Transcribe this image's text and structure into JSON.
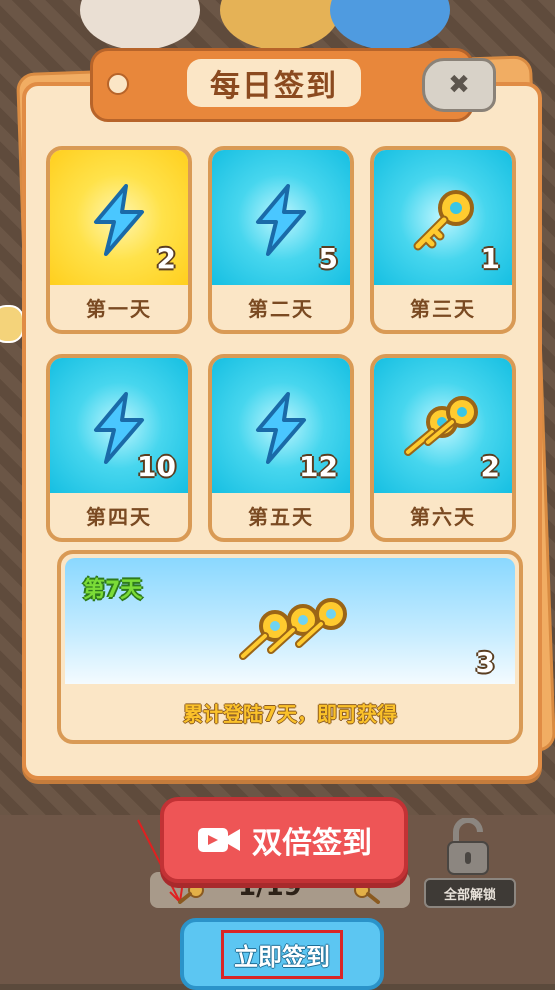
{
  "title": "每日签到",
  "close_icon": "close-x-icon",
  "days": [
    {
      "label": "第一天",
      "reward": "lightning-energy-icon",
      "count": "2",
      "highlight": true
    },
    {
      "label": "第二天",
      "reward": "lightning-energy-icon",
      "count": "5",
      "highlight": false
    },
    {
      "label": "第三天",
      "reward": "golden-key-icon",
      "count": "1",
      "highlight": false
    },
    {
      "label": "第四天",
      "reward": "lightning-energy-icon",
      "count": "10",
      "highlight": false
    },
    {
      "label": "第五天",
      "reward": "lightning-energy-icon",
      "count": "12",
      "highlight": false
    },
    {
      "label": "第六天",
      "reward": "golden-keys-icon",
      "count": "2",
      "highlight": false
    }
  ],
  "week_reward": {
    "label": "第7天",
    "reward": "golden-keys-bundle-icon",
    "count": "3",
    "caption": "累计登陆7天，即可获得"
  },
  "double_signin_label": "双倍签到",
  "progress_text": "1/19",
  "unlock_all_label": "全部解锁",
  "signin_label": "立即签到",
  "colors": {
    "panel_border": "#e08c45",
    "double_button": "#ee5556",
    "signin_button": "#5cc6f2",
    "highlight_box": "#d92626"
  }
}
